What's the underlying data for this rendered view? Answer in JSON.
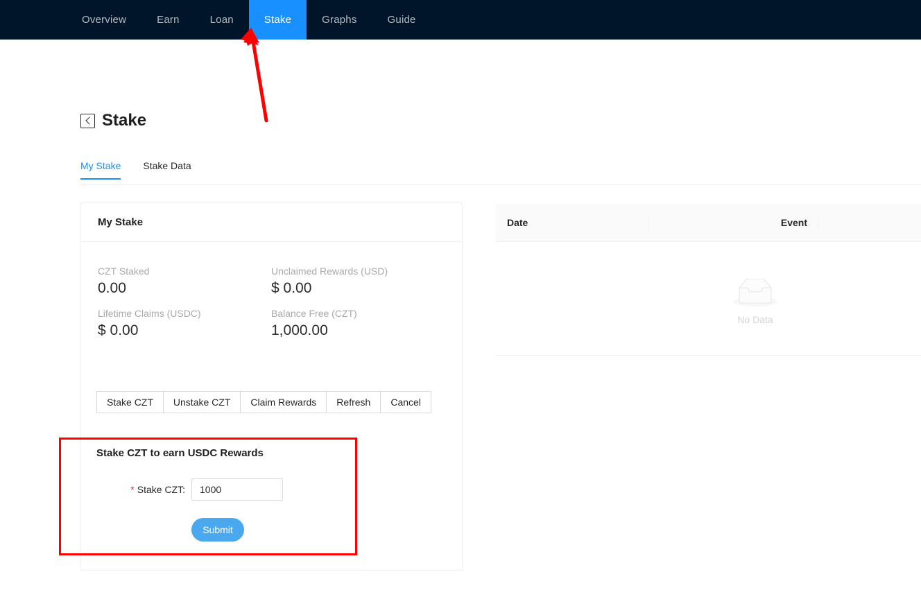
{
  "nav": {
    "items": [
      {
        "label": "Overview",
        "active": false
      },
      {
        "label": "Earn",
        "active": false
      },
      {
        "label": "Loan",
        "active": false
      },
      {
        "label": "Stake",
        "active": true
      },
      {
        "label": "Graphs",
        "active": false
      },
      {
        "label": "Guide",
        "active": false
      }
    ],
    "background_color": "#001529",
    "active_color": "#1890ff"
  },
  "page": {
    "title": "Stake",
    "back_icon": "chevron-left-boxed-icon"
  },
  "tabs": [
    {
      "label": "My Stake",
      "active": true
    },
    {
      "label": "Stake Data",
      "active": false
    }
  ],
  "stake_card": {
    "title": "My Stake",
    "stats": [
      {
        "label": "CZT Staked",
        "value": "0.00"
      },
      {
        "label": "Unclaimed Rewards (USD)",
        "value": "$ 0.00"
      },
      {
        "label": "Lifetime Claims (USDC)",
        "value": "$ 0.00"
      },
      {
        "label": "Balance Free (CZT)",
        "value": "1,000.00"
      }
    ],
    "buttons": [
      {
        "label": "Stake CZT"
      },
      {
        "label": "Unstake CZT"
      },
      {
        "label": "Claim Rewards"
      },
      {
        "label": "Refresh"
      },
      {
        "label": "Cancel"
      }
    ]
  },
  "form": {
    "title": "Stake CZT to earn USDC Rewards",
    "required_marker": "*",
    "field_label": "Stake CZT:",
    "field_value": "1000",
    "field_placeholder": "",
    "submit_label": "Submit",
    "submit_color": "#4aa8ef"
  },
  "event_table": {
    "columns": [
      {
        "key": "date",
        "label": "Date"
      },
      {
        "key": "event",
        "label": "Event"
      }
    ],
    "rows": [],
    "empty_text": "No Data",
    "empty_icon": "empty-inbox-icon"
  },
  "annotations": {
    "highlight_color": "#ff0000",
    "arrow_target": "Stake",
    "box_target": "stake-form"
  }
}
